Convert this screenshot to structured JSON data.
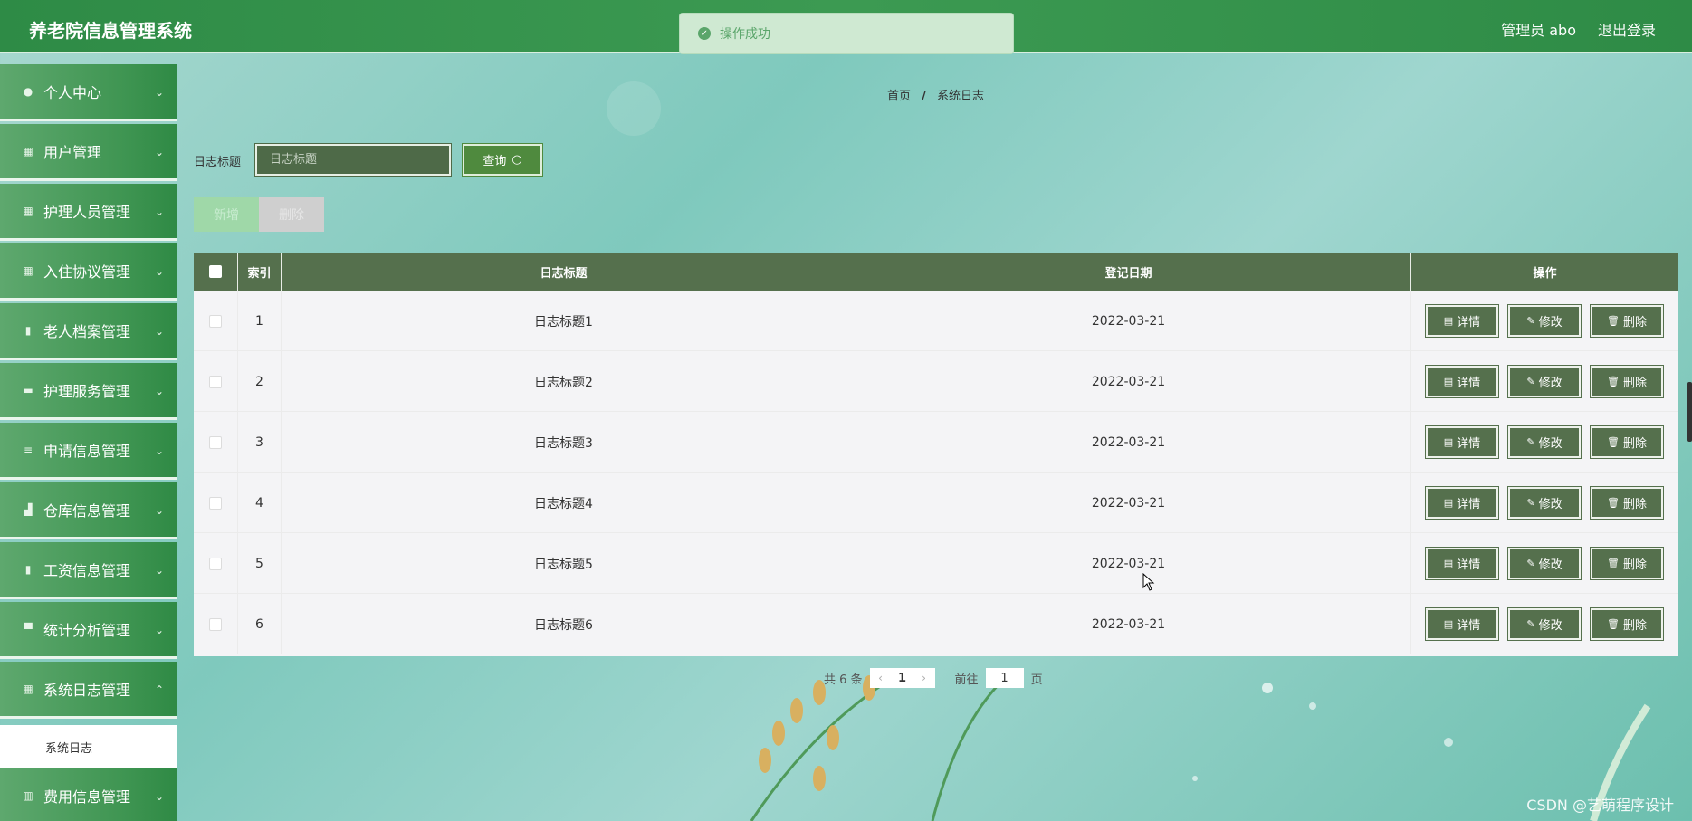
{
  "header": {
    "title": "养老院信息管理系统",
    "user": "管理员 abo",
    "logout": "退出登录"
  },
  "toast": {
    "message": "操作成功"
  },
  "sidebar": {
    "items": [
      {
        "label": "个人中心",
        "icon": "user-icon"
      },
      {
        "label": "用户管理",
        "icon": "grid-icon"
      },
      {
        "label": "护理人员管理",
        "icon": "grid-icon"
      },
      {
        "label": "入住协议管理",
        "icon": "grid-icon"
      },
      {
        "label": "老人档案管理",
        "icon": "clipboard-icon"
      },
      {
        "label": "护理服务管理",
        "icon": "briefcase-icon"
      },
      {
        "label": "申请信息管理",
        "icon": "sliders-icon"
      },
      {
        "label": "仓库信息管理",
        "icon": "warehouse-icon"
      },
      {
        "label": "工资信息管理",
        "icon": "clipboard-icon"
      },
      {
        "label": "统计分析管理",
        "icon": "monitor-icon"
      },
      {
        "label": "系统日志管理",
        "icon": "grid-icon"
      }
    ],
    "sub_item": "系统日志",
    "last_item": {
      "label": "费用信息管理",
      "icon": "chart-icon"
    }
  },
  "breadcrumb": {
    "home": "首页",
    "sep": "/",
    "current": "系统日志"
  },
  "search": {
    "label": "日志标题",
    "placeholder": "日志标题",
    "button": "查询"
  },
  "actions": {
    "add": "新增",
    "delete": "删除"
  },
  "table": {
    "columns": [
      "索引",
      "日志标题",
      "登记日期",
      "操作"
    ],
    "rows": [
      {
        "index": "1",
        "title": "日志标题1",
        "date": "2022-03-21"
      },
      {
        "index": "2",
        "title": "日志标题2",
        "date": "2022-03-21"
      },
      {
        "index": "3",
        "title": "日志标题3",
        "date": "2022-03-21"
      },
      {
        "index": "4",
        "title": "日志标题4",
        "date": "2022-03-21"
      },
      {
        "index": "5",
        "title": "日志标题5",
        "date": "2022-03-21"
      },
      {
        "index": "6",
        "title": "日志标题6",
        "date": "2022-03-21"
      }
    ],
    "row_actions": {
      "detail": "详情",
      "edit": "修改",
      "delete": "删除"
    }
  },
  "pagination": {
    "total": "共 6 条",
    "page": "1",
    "goto": "前往",
    "goto_value": "1",
    "unit": "页"
  },
  "watermark": "CSDN @艺萌程序设计",
  "colors": {
    "header": "#2e8b46",
    "table_header": "#55704d",
    "button": "#55704d"
  }
}
